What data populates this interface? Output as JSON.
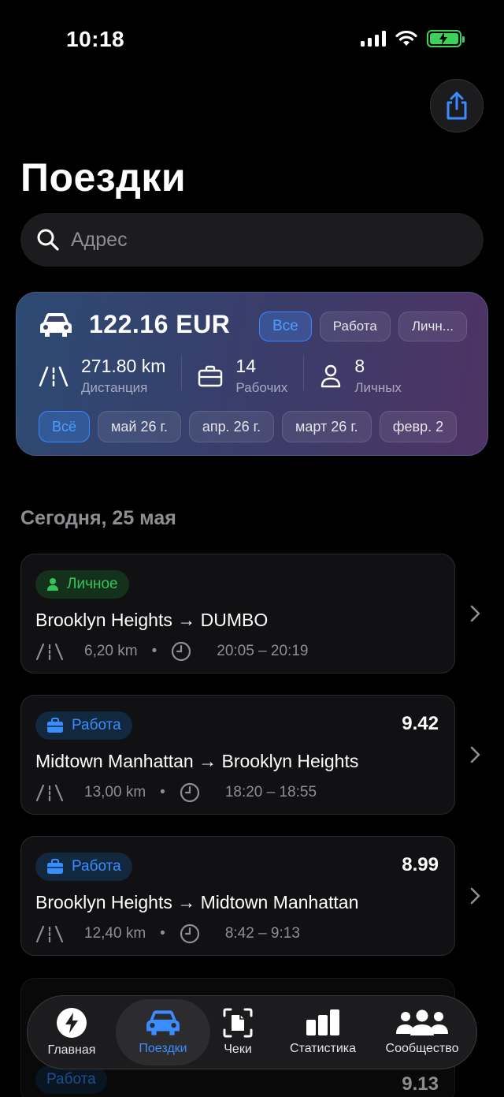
{
  "status_bar": {
    "time": "10:18"
  },
  "page_title": "Поездки",
  "search": {
    "placeholder": "Адрес"
  },
  "summary": {
    "amount": "122.16 EUR",
    "type_filters": [
      "Все",
      "Работа",
      "Личн..."
    ],
    "stats": {
      "distance_value": "271.80 km",
      "distance_label": "Дистанция",
      "work_value": "14",
      "work_label": "Рабочих",
      "personal_value": "8",
      "personal_label": "Личных"
    },
    "month_filters": [
      "Всё",
      "май 26 г.",
      "апр. 26 г.",
      "март 26 г.",
      "февр. 2"
    ]
  },
  "section_header": "Сегодня, 25 мая",
  "trips": [
    {
      "badge": "Личное",
      "amount": "",
      "route": "Brooklyn Heights → DUMBO",
      "distance": "6,20 km",
      "time": "20:05 – 20:19"
    },
    {
      "badge": "Работа",
      "amount": "9.42",
      "route": "Midtown Manhattan → Brooklyn Heights",
      "distance": "13,00 km",
      "time": "18:20 – 18:55"
    },
    {
      "badge": "Работа",
      "amount": "8.99",
      "route": "Brooklyn Heights → Midtown Manhattan",
      "distance": "12,40 km",
      "time": "8:42 – 9:13"
    }
  ],
  "partial_trip": {
    "badge": "Работа",
    "amount": "9.13"
  },
  "tabbar": {
    "tabs": [
      "Главная",
      "Поездки",
      "Чеки",
      "Статистика",
      "Сообщество"
    ],
    "active": "Поездки"
  },
  "colors": {
    "accent": "#3a8dff",
    "personal": "#36c25a",
    "background": "#000000"
  }
}
